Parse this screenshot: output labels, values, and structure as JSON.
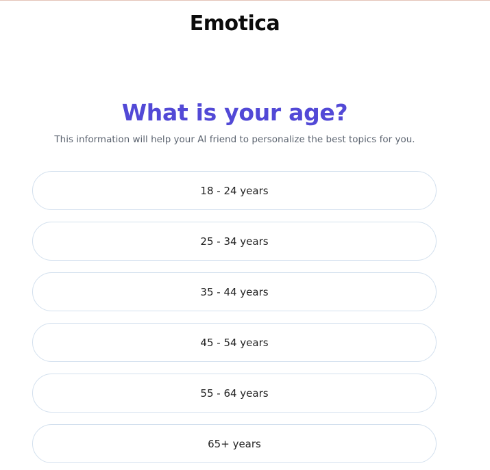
{
  "brand": {
    "name": "Emotica"
  },
  "heading": {
    "title": "What is your age?",
    "subtitle": "This information will help your AI friend to personalize the best topics for you."
  },
  "options": [
    {
      "label": "18 - 24 years"
    },
    {
      "label": "25 - 34 years"
    },
    {
      "label": "35 - 44 years"
    },
    {
      "label": "45 - 54 years"
    },
    {
      "label": "55 - 64 years"
    },
    {
      "label": "65+ years"
    }
  ],
  "colors": {
    "accent": "#5249d6",
    "option_border": "#d3e0ee",
    "top_border": "#e4c3b8"
  }
}
